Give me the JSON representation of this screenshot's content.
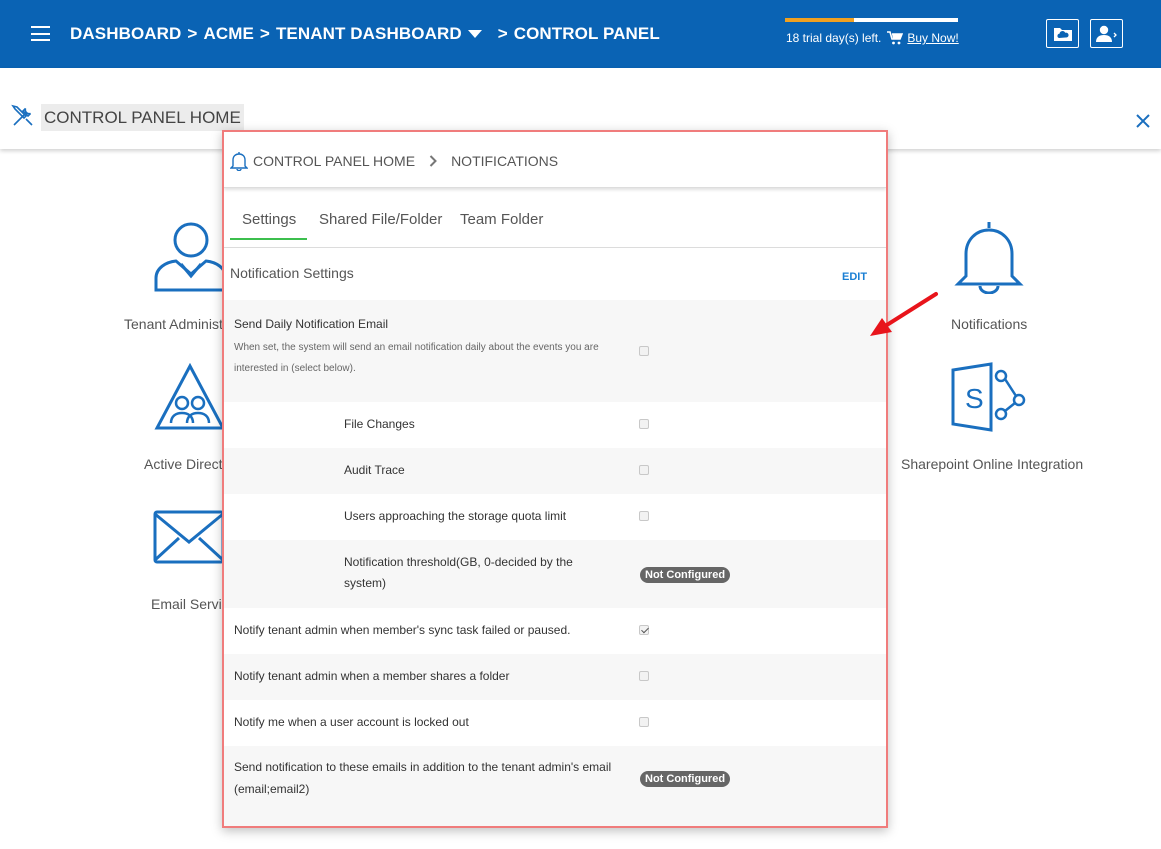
{
  "topbar": {
    "breadcrumb": [
      "DASHBOARD",
      "ACME",
      "TENANT DASHBOARD",
      "CONTROL PANEL"
    ],
    "separator": ">",
    "trial_text": "18 trial day(s) left.",
    "buy_label": "Buy Now!",
    "trial_progress": 0.4
  },
  "control_panel": {
    "title": "CONTROL PANEL HOME"
  },
  "tiles": {
    "tenant_admin": "Tenant Administ",
    "active_directory": "Active Directo",
    "email_service": "Email Servic",
    "notifications": "Notifications",
    "sharepoint": "Sharepoint Online Integration"
  },
  "modal": {
    "breadcrumb_home": "CONTROL PANEL HOME",
    "breadcrumb_current": "NOTIFICATIONS",
    "tabs": [
      "Settings",
      "Shared File/Folder",
      "Team Folder"
    ],
    "section_title": "Notification Settings",
    "edit_label": "EDIT",
    "rows": {
      "daily_email": {
        "label": "Send Daily Notification Email",
        "desc_line1": "When set, the system will send an email notification daily about the events you are",
        "desc_line2": "interested in (select below).",
        "checked": false
      },
      "file_changes": {
        "label": "File Changes",
        "checked": false
      },
      "audit_trace": {
        "label": "Audit Trace",
        "checked": false
      },
      "quota": {
        "label": "Users approaching the storage quota limit",
        "checked": false
      },
      "threshold": {
        "label_line1": "Notification threshold(GB, 0-decided by the",
        "label_line2": "system)",
        "badge": "Not Configured"
      },
      "sync_failed": {
        "label": "Notify tenant admin when member's sync task failed or paused.",
        "checked": true
      },
      "share_folder": {
        "label": "Notify tenant admin when a member shares a folder",
        "checked": false
      },
      "locked_out": {
        "label": "Notify me when a user account is locked out",
        "checked": false
      },
      "extra_emails": {
        "label_line1": "Send notification to these emails in addition to the tenant admin's email",
        "label_line2": "(email;email2)",
        "badge": "Not Configured"
      }
    }
  },
  "colors": {
    "brand_blue": "#0a63b4",
    "icon_blue": "#1a6fbf",
    "tab_active": "#3cbf4e",
    "modal_border": "#f07c7c",
    "arrow": "#e8141b"
  }
}
